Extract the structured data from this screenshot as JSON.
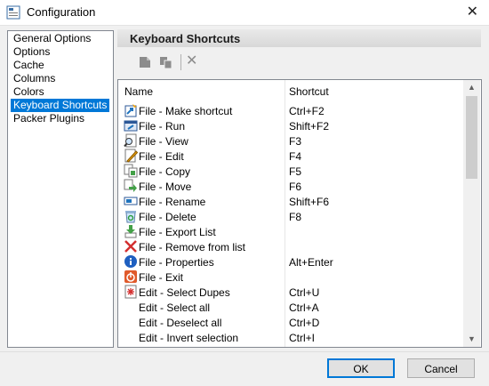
{
  "window": {
    "title": "Configuration",
    "close_glyph": "✕"
  },
  "nav": {
    "items": [
      {
        "label": "General Options",
        "selected": false
      },
      {
        "label": "Options",
        "selected": false
      },
      {
        "label": "Cache",
        "selected": false
      },
      {
        "label": "Columns",
        "selected": false
      },
      {
        "label": "Colors",
        "selected": false
      },
      {
        "label": "Keyboard Shortcuts",
        "selected": true
      },
      {
        "label": "Packer Plugins",
        "selected": false
      }
    ]
  },
  "panel": {
    "title": "Keyboard Shortcuts"
  },
  "toolbar": {
    "icons": [
      "new-shortcut-icon",
      "copy-shortcut-icon",
      "delete-shortcut-icon"
    ],
    "delete_glyph": "✕"
  },
  "grid": {
    "columns": [
      "Name",
      "Shortcut"
    ],
    "rows": [
      {
        "name": "File - Make shortcut",
        "key": "Ctrl+F2",
        "icon": "shortcut-icon"
      },
      {
        "name": "File - Run",
        "key": "Shift+F2",
        "icon": "run-icon"
      },
      {
        "name": "File - View",
        "key": "F3",
        "icon": "view-icon"
      },
      {
        "name": "File - Edit",
        "key": "F4",
        "icon": "edit-icon"
      },
      {
        "name": "File - Copy",
        "key": "F5",
        "icon": "copy-icon"
      },
      {
        "name": "File - Move",
        "key": "F6",
        "icon": "move-icon"
      },
      {
        "name": "File - Rename",
        "key": "Shift+F6",
        "icon": "rename-icon"
      },
      {
        "name": "File - Delete",
        "key": "F8",
        "icon": "recycle-icon"
      },
      {
        "name": "File - Export List",
        "key": "",
        "icon": "export-icon"
      },
      {
        "name": "File - Remove from list",
        "key": "",
        "icon": "remove-icon"
      },
      {
        "name": "File - Properties",
        "key": "Alt+Enter",
        "icon": "info-icon"
      },
      {
        "name": "File - Exit",
        "key": "",
        "icon": "exit-icon"
      },
      {
        "name": "Edit - Select Dupes",
        "key": "Ctrl+U",
        "icon": "dupes-icon"
      },
      {
        "name": "Edit - Select all",
        "key": "Ctrl+A",
        "icon": ""
      },
      {
        "name": "Edit - Deselect all",
        "key": "Ctrl+D",
        "icon": ""
      },
      {
        "name": "Edit - Invert selection",
        "key": "Ctrl+I",
        "icon": ""
      }
    ]
  },
  "scrollbar": {
    "up": "▲",
    "down": "▼"
  },
  "buttons": {
    "ok": "OK",
    "cancel": "Cancel"
  },
  "colors": {
    "selection": "#0078d7",
    "accent": "#0078d7"
  }
}
